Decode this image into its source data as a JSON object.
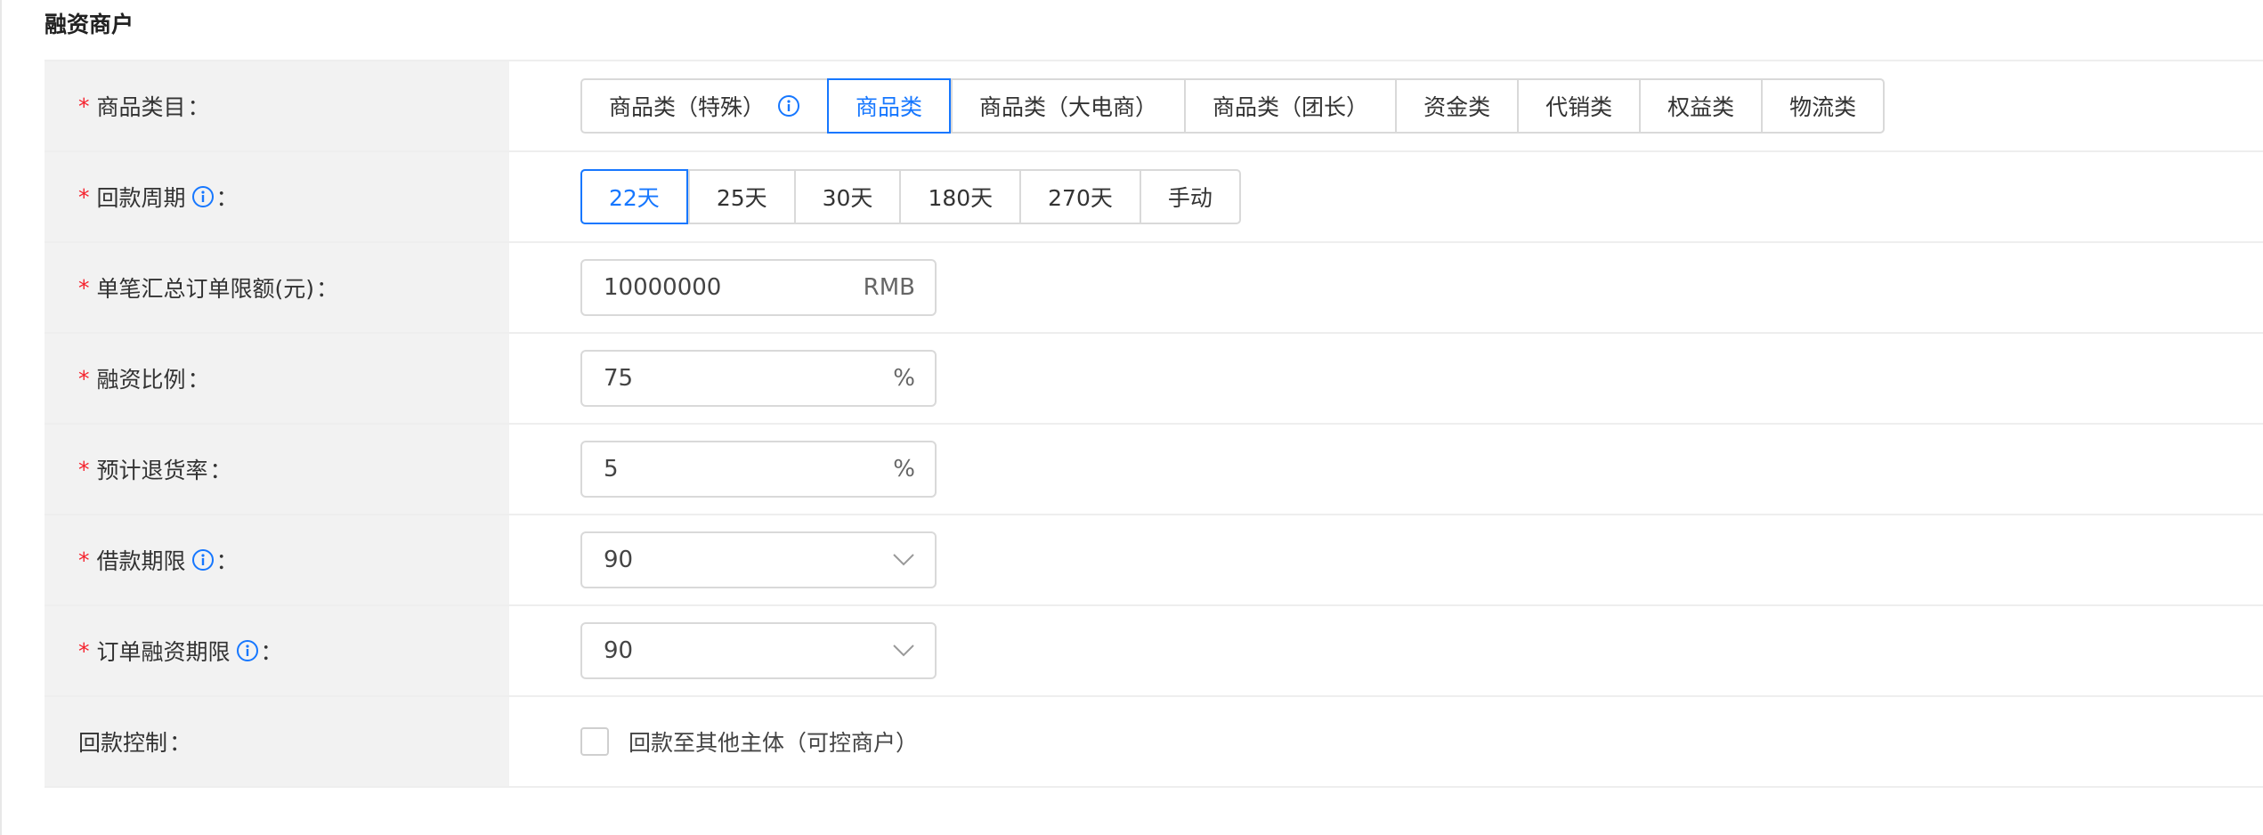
{
  "section": {
    "title": "融资商户"
  },
  "colon": "：",
  "colors": {
    "accent": "#1677ff",
    "required": "#f5222d"
  },
  "rows": {
    "category": {
      "label": "商品类目",
      "options": [
        "商品类（特殊）",
        "商品类",
        "商品类（大电商）",
        "商品类（团长）",
        "资金类",
        "代销类",
        "权益类",
        "物流类"
      ],
      "selected": "商品类"
    },
    "repayment_cycle": {
      "label": "回款周期",
      "options": [
        "22天",
        "25天",
        "30天",
        "180天",
        "270天",
        "手动"
      ],
      "selected": "22天"
    },
    "order_limit": {
      "label": "单笔汇总订单限额(元)",
      "value": "10000000",
      "suffix": "RMB"
    },
    "financing_ratio": {
      "label": "融资比例",
      "value": "75",
      "suffix": "%"
    },
    "return_rate": {
      "label": "预计退货率",
      "value": "5",
      "suffix": "%"
    },
    "loan_term": {
      "label": "借款期限",
      "value": "90"
    },
    "order_financing_term": {
      "label": "订单融资期限",
      "value": "90"
    },
    "repayment_control": {
      "label": "回款控制",
      "checkbox_label": "回款至其他主体（可控商户）",
      "checked": false
    }
  }
}
